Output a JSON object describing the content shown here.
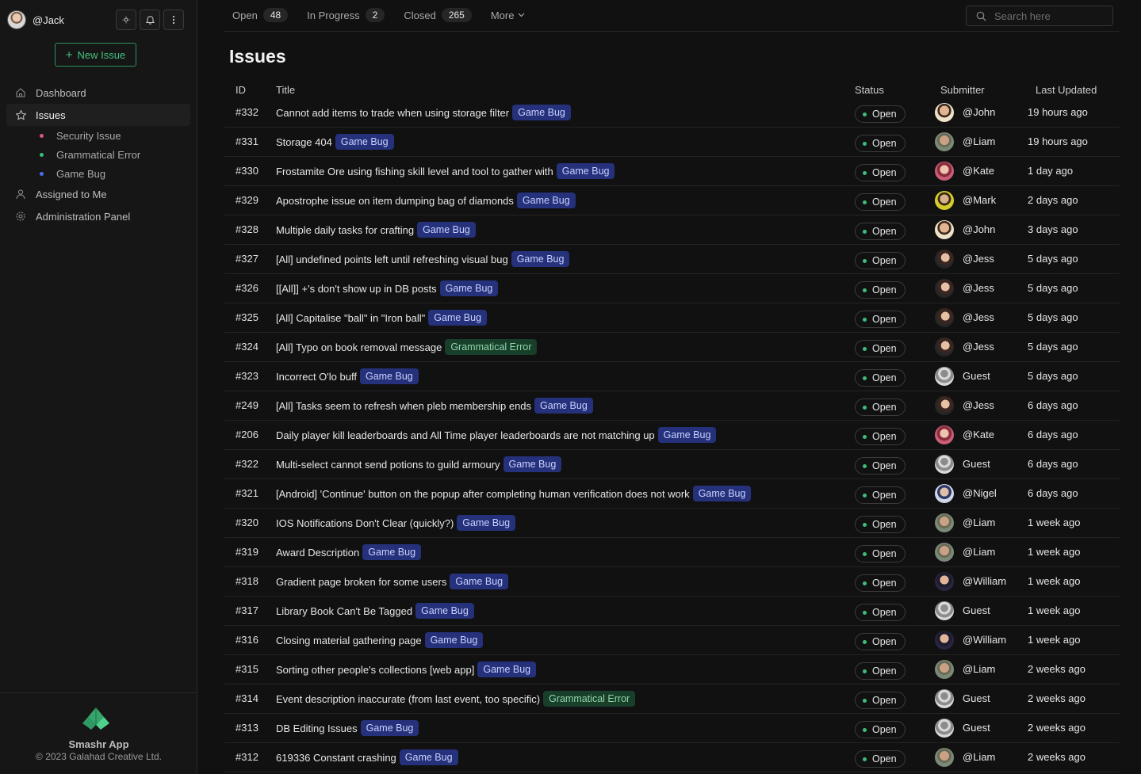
{
  "user": {
    "handle": "@Jack"
  },
  "sidebar": {
    "new_issue_label": "New Issue",
    "items": [
      {
        "label": "Dashboard"
      },
      {
        "label": "Issues"
      },
      {
        "label": "Assigned to Me"
      },
      {
        "label": "Administration Panel"
      }
    ],
    "sub_items": [
      {
        "label": "Security Issue",
        "color": "#e0508a"
      },
      {
        "label": "Grammatical Error",
        "color": "#3bbf7a"
      },
      {
        "label": "Game Bug",
        "color": "#4a6cf0"
      }
    ]
  },
  "footer": {
    "app_name": "Smashr App",
    "copyright": "© 2023 Galahad Creative Ltd."
  },
  "tabs": [
    {
      "label": "Open",
      "count": "48"
    },
    {
      "label": "In Progress",
      "count": "2"
    },
    {
      "label": "Closed",
      "count": "265"
    },
    {
      "label": "More",
      "count": ""
    }
  ],
  "search": {
    "placeholder": "Search here"
  },
  "page_title": "Issues",
  "columns": {
    "id": "ID",
    "title": "Title",
    "status": "Status",
    "submitter": "Submitter",
    "updated": "Last Updated"
  },
  "rows": [
    {
      "id": "#332",
      "title": "Cannot add items to trade when using storage filter",
      "tag": "Game Bug",
      "status": "Open",
      "submitter": "@John",
      "avatar": "john",
      "updated": "19 hours ago"
    },
    {
      "id": "#331",
      "title": "Storage 404",
      "tag": "Game Bug",
      "status": "Open",
      "submitter": "@Liam",
      "avatar": "liam",
      "updated": "19 hours ago"
    },
    {
      "id": "#330",
      "title": "Frostamite Ore using fishing skill level and tool to gather with",
      "tag": "Game Bug",
      "status": "Open",
      "submitter": "@Kate",
      "avatar": "kate",
      "updated": "1 day ago"
    },
    {
      "id": "#329",
      "title": "Apostrophe issue on item dumping bag of diamonds",
      "tag": "Game Bug",
      "status": "Open",
      "submitter": "@Mark",
      "avatar": "mark",
      "updated": "2 days ago"
    },
    {
      "id": "#328",
      "title": "Multiple daily tasks for crafting",
      "tag": "Game Bug",
      "status": "Open",
      "submitter": "@John",
      "avatar": "john",
      "updated": "3 days ago"
    },
    {
      "id": "#327",
      "title": "[All] undefined points left until refreshing visual bug",
      "tag": "Game Bug",
      "status": "Open",
      "submitter": "@Jess",
      "avatar": "jess",
      "updated": "5 days ago"
    },
    {
      "id": "#326",
      "title": "[[All]] +'s don't show up in DB posts",
      "tag": "Game Bug",
      "status": "Open",
      "submitter": "@Jess",
      "avatar": "jess",
      "updated": "5 days ago"
    },
    {
      "id": "#325",
      "title": "[All] Capitalise \"ball\" in \"Iron ball\"",
      "tag": "Game Bug",
      "status": "Open",
      "submitter": "@Jess",
      "avatar": "jess",
      "updated": "5 days ago"
    },
    {
      "id": "#324",
      "title": "[All] Typo on book removal message",
      "tag": "Grammatical Error",
      "status": "Open",
      "submitter": "@Jess",
      "avatar": "jess",
      "updated": "5 days ago"
    },
    {
      "id": "#323",
      "title": "Incorrect O'lo buff",
      "tag": "Game Bug",
      "status": "Open",
      "submitter": "Guest",
      "avatar": "guest",
      "updated": "5 days ago"
    },
    {
      "id": "#249",
      "title": "[All] Tasks seem to refresh when pleb membership ends",
      "tag": "Game Bug",
      "status": "Open",
      "submitter": "@Jess",
      "avatar": "jess",
      "updated": "6 days ago"
    },
    {
      "id": "#206",
      "title": "Daily player kill leaderboards and All Time player leaderboards are not matching up",
      "tag": "Game Bug",
      "status": "Open",
      "submitter": "@Kate",
      "avatar": "kate",
      "updated": "6 days ago"
    },
    {
      "id": "#322",
      "title": "Multi-select cannot send potions to guild armoury",
      "tag": "Game Bug",
      "status": "Open",
      "submitter": "Guest",
      "avatar": "guest",
      "updated": "6 days ago"
    },
    {
      "id": "#321",
      "title": "[Android] 'Continue' button on the popup after completing human verification does not work",
      "tag": "Game Bug",
      "status": "Open",
      "submitter": "@Nigel",
      "avatar": "nigel",
      "updated": "6 days ago"
    },
    {
      "id": "#320",
      "title": "IOS Notifications Don't Clear (quickly?)",
      "tag": "Game Bug",
      "status": "Open",
      "submitter": "@Liam",
      "avatar": "liam",
      "updated": "1 week ago"
    },
    {
      "id": "#319",
      "title": "Award Description",
      "tag": "Game Bug",
      "status": "Open",
      "submitter": "@Liam",
      "avatar": "liam",
      "updated": "1 week ago"
    },
    {
      "id": "#318",
      "title": "Gradient page broken for some users",
      "tag": "Game Bug",
      "status": "Open",
      "submitter": "@William",
      "avatar": "william",
      "updated": "1 week ago"
    },
    {
      "id": "#317",
      "title": "Library Book Can't Be Tagged",
      "tag": "Game Bug",
      "status": "Open",
      "submitter": "Guest",
      "avatar": "guest",
      "updated": "1 week ago"
    },
    {
      "id": "#316",
      "title": "Closing material gathering page",
      "tag": "Game Bug",
      "status": "Open",
      "submitter": "@William",
      "avatar": "william",
      "updated": "1 week ago"
    },
    {
      "id": "#315",
      "title": "Sorting other people's collections [web app]",
      "tag": "Game Bug",
      "status": "Open",
      "submitter": "@Liam",
      "avatar": "liam",
      "updated": "2 weeks ago"
    },
    {
      "id": "#314",
      "title": "Event description inaccurate (from last event, too specific)",
      "tag": "Grammatical Error",
      "status": "Open",
      "submitter": "Guest",
      "avatar": "guest",
      "updated": "2 weeks ago"
    },
    {
      "id": "#313",
      "title": "DB Editing Issues",
      "tag": "Game Bug",
      "status": "Open",
      "submitter": "Guest",
      "avatar": "guest",
      "updated": "2 weeks ago"
    },
    {
      "id": "#312",
      "title": "619336 Constant crashing",
      "tag": "Game Bug",
      "status": "Open",
      "submitter": "@Liam",
      "avatar": "liam",
      "updated": "2 weeks ago"
    }
  ]
}
